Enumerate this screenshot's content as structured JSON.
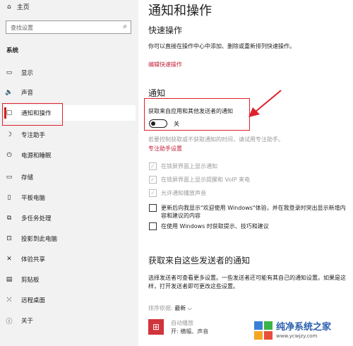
{
  "sidebar": {
    "home_label": "主页",
    "home_icon": "home-icon",
    "search_placeholder": "查找设置",
    "section_label": "系统",
    "items": [
      {
        "label": "显示",
        "icon": "monitor-icon",
        "glyph": "▭"
      },
      {
        "label": "声音",
        "icon": "speaker-icon",
        "glyph": "🔈"
      },
      {
        "label": "通知和操作",
        "icon": "message-icon",
        "glyph": "▢"
      },
      {
        "label": "专注助手",
        "icon": "moon-icon",
        "glyph": "☽"
      },
      {
        "label": "电源和睡眠",
        "icon": "power-icon",
        "glyph": "⏻"
      },
      {
        "label": "存储",
        "icon": "storage-icon",
        "glyph": "▭"
      },
      {
        "label": "平板电脑",
        "icon": "tablet-icon",
        "glyph": "▯"
      },
      {
        "label": "多任务处理",
        "icon": "multitask-icon",
        "glyph": "⧉"
      },
      {
        "label": "投影到此电脑",
        "icon": "project-icon",
        "glyph": "⊡"
      },
      {
        "label": "体验共享",
        "icon": "share-icon",
        "glyph": "✕"
      },
      {
        "label": "剪贴板",
        "icon": "clipboard-icon",
        "glyph": "▤"
      },
      {
        "label": "远程桌面",
        "icon": "remote-icon",
        "glyph": "⤫"
      },
      {
        "label": "关于",
        "icon": "info-icon",
        "glyph": "ⓘ"
      }
    ]
  },
  "main": {
    "title": "通知和操作",
    "quick_actions_heading": "快速操作",
    "quick_actions_desc": "你可以直接在操作中心中添加、删除或重新排列快速操作。",
    "edit_quick_actions_link": "编辑快速操作",
    "notifications_heading": "通知",
    "get_notifications_label": "获取来自应用和其他发送者的通知",
    "toggle_state": "关",
    "toggle_on": false,
    "focus_desc": "若要控制获取或不获取通知的时间，请试用专注助手。",
    "focus_link": "专注助手设置",
    "checkboxes": [
      {
        "label": "在锁屏界面上显示通知",
        "checked": true,
        "disabled": true
      },
      {
        "label": "在锁屏界面上显示提醒和 VoIP 来电",
        "checked": true,
        "disabled": true
      },
      {
        "label": "允许通知播放声音",
        "checked": true,
        "disabled": true
      },
      {
        "label": "更新后向我显示\"欢迎使用 Windows\"体验，并在我登录时突出显示新增内容和建议的内容",
        "checked": false,
        "disabled": false
      },
      {
        "label": "在使用 Windows 时获取提示、技巧和建议",
        "checked": false,
        "disabled": false
      }
    ],
    "senders_heading": "获取来自这些发送者的通知",
    "senders_desc": "选择发送者可查看更多设置。一些发送者还可能有其自己的通知设置。如果是这样，打开发送者即可更改这些设置。",
    "sort_label": "排序依据: ",
    "sort_value": "最新",
    "app_name": "自动播放",
    "app_status": "开: 横幅、声音"
  },
  "watermark": {
    "title": "纯净系统之家",
    "url": "www.ycwjzy.com",
    "colors": [
      "#3a7fd5",
      "#39b54a",
      "#f5a623",
      "#e94e3c"
    ]
  },
  "colors": {
    "accent": "#c2213b",
    "highlight_box": "#e0202a",
    "sidebar_bg": "#f2f2f2"
  }
}
